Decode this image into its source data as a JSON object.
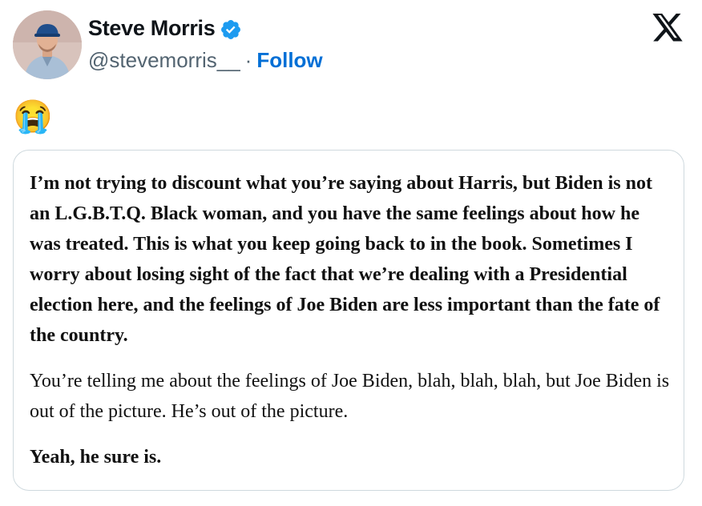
{
  "author": {
    "display_name": "Steve Morris",
    "handle": "@stevemorris__",
    "separator": "·",
    "follow_label": "Follow",
    "verified_color": "#1d9bf0"
  },
  "brand": {
    "logo_icon": "x-logo-icon"
  },
  "tweet": {
    "emoji": "😭"
  },
  "quote": {
    "paragraph_1": "I’m not trying to discount what you’re saying about Harris, but Biden is not an L.G.B.T.Q. Black woman, and you have the same feelings about how he was treated. This is what you keep going back to in the book. Sometimes I worry about losing sight of the fact that we’re dealing with a Presidential election here, and the feelings of Joe Biden are less important than the fate of the country.",
    "paragraph_2": "You’re telling me about the feelings of Joe Biden, blah, blah, blah, but Joe Biden is out of the picture. He’s out of the picture.",
    "paragraph_3": "Yeah, he sure is."
  }
}
